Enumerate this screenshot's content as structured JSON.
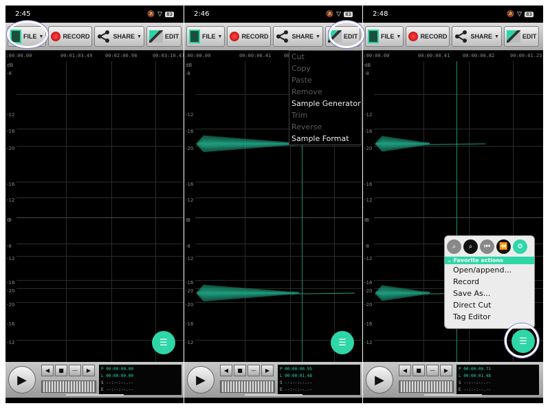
{
  "panels": [
    {
      "time": "2:45",
      "battery": "83",
      "toolbar": {
        "file": "FILE",
        "record": "RECORD",
        "share": "SHARE",
        "edit": "EDIT"
      },
      "timeline": [
        "00:00:00.00",
        "00:01:03.49",
        "00:02:06.98",
        "00:03:10.47"
      ],
      "lcd": {
        "p": "P 00:00:00.00",
        "l": "L 00:00:00.00",
        "s": "S --:--:--.--",
        "e": "E --:--:--.--"
      }
    },
    {
      "time": "2:46",
      "battery": "83",
      "toolbar": {
        "file": "FILE",
        "record": "RECORD",
        "share": "SHARE",
        "edit": "EDIT"
      },
      "timeline": [
        "00:00:00.00",
        "00:00:00.41",
        "00:00:00.82"
      ],
      "lcd": {
        "p": "P 00:00:00.95",
        "l": "L 00:00:01.48",
        "s": "S --:--:--.--",
        "e": "E --:--:--.--"
      }
    },
    {
      "time": "2:48",
      "battery": "83",
      "toolbar": {
        "file": "FILE",
        "record": "RECORD",
        "share": "SHARE",
        "edit": "EDIT"
      },
      "timeline": [
        "00:00:00.00",
        "00:00:00.41",
        "00:00:00.82",
        "00:00:01.23"
      ],
      "lcd": {
        "p": "P 00:00:00.71",
        "l": "L 00:00:01.48",
        "s": "S --:--:--.--",
        "e": "E --:--:--.--"
      }
    }
  ],
  "db_labels": [
    "dB",
    "-8",
    "-12",
    "-16",
    "-20",
    "-16",
    "-12",
    "-8",
    "0",
    "-8",
    "-12",
    "-16",
    "-20",
    "-20",
    "-16",
    "-12",
    "-8"
  ],
  "edit_menu": [
    {
      "label": "Cut",
      "enabled": false
    },
    {
      "label": "Copy",
      "enabled": false
    },
    {
      "label": "Paste",
      "enabled": false
    },
    {
      "label": "Remove",
      "enabled": false
    },
    {
      "label": "Sample Generator",
      "enabled": true
    },
    {
      "label": "Trim",
      "enabled": false
    },
    {
      "label": "Reverse",
      "enabled": false
    },
    {
      "label": "Sample Format",
      "enabled": true
    }
  ],
  "favorites": {
    "section": "Favorite actions",
    "items": [
      "Open/append...",
      "Record",
      "Save As...",
      "Direct Cut",
      "Tag Editor"
    ]
  },
  "colors": {
    "accent": "#2ed6a8",
    "waveform": "#1e9e7e",
    "background": "#000000"
  }
}
